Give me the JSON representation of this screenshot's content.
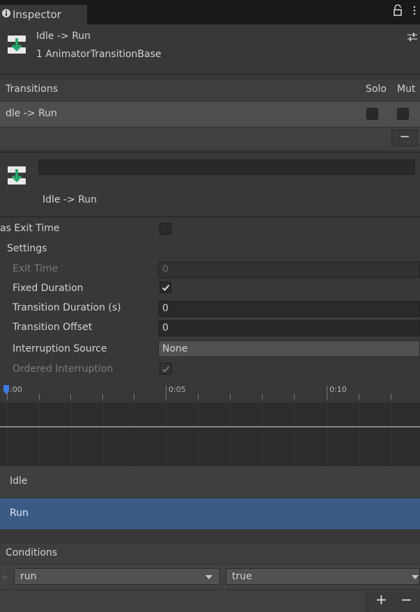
{
  "tab": {
    "label": "Inspector"
  },
  "header": {
    "title": "Idle -> Run",
    "subtitle": "1 AnimatorTransitionBase"
  },
  "transitions": {
    "header": "Transitions",
    "solo_label": "Solo",
    "mute_label": "Mut",
    "rows": [
      {
        "label": "dle -> Run"
      }
    ],
    "remove_label": "−"
  },
  "selected": {
    "title": "Idle -> Run"
  },
  "props": {
    "has_exit_time": "as Exit Time",
    "settings": "Settings",
    "exit_time": {
      "label": "Exit Time",
      "value": "0"
    },
    "fixed_duration": {
      "label": "Fixed Duration"
    },
    "transition_duration": {
      "label": "Transition Duration (s)",
      "value": "0"
    },
    "transition_offset": {
      "label": "Transition Offset",
      "value": "0"
    },
    "interruption_source": {
      "label": "Interruption Source",
      "value": "None"
    },
    "ordered_interruption": {
      "label": "Ordered Interruption"
    }
  },
  "timeline": {
    "ticks": [
      ":00",
      "0:05",
      "0:10"
    ],
    "states": {
      "idle": "Idle",
      "run": "Run"
    }
  },
  "conditions": {
    "header": "Conditions",
    "items": [
      {
        "param": "run",
        "value": "true"
      }
    ],
    "add_label": "+",
    "remove_label": "−"
  },
  "colors": {
    "accent": "#3c5a86",
    "background": "#383838"
  }
}
